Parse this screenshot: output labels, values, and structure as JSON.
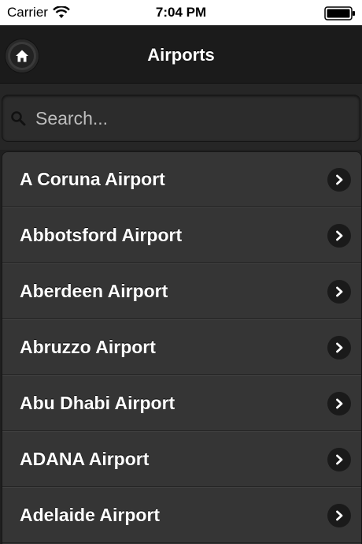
{
  "status_bar": {
    "carrier": "Carrier",
    "time": "7:04 PM",
    "wifi_icon": "wifi-icon",
    "battery_icon": "battery-icon"
  },
  "header": {
    "title": "Airports",
    "home_icon": "home-icon"
  },
  "search": {
    "placeholder": "Search...",
    "value": "",
    "icon": "search-icon"
  },
  "airports": [
    {
      "label": "A Coruna Airport"
    },
    {
      "label": "Abbotsford Airport"
    },
    {
      "label": "Aberdeen Airport"
    },
    {
      "label": "Abruzzo Airport"
    },
    {
      "label": "Abu Dhabi Airport"
    },
    {
      "label": "ADANA Airport"
    },
    {
      "label": "Adelaide Airport"
    }
  ],
  "colors": {
    "header_bg": "#1b1b1b",
    "list_bg": "#353535",
    "text": "#ffffff"
  }
}
